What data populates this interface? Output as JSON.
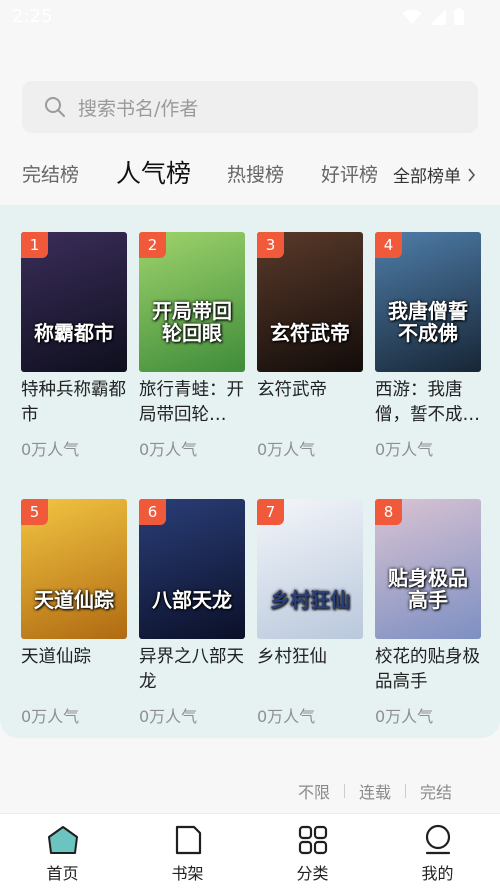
{
  "status_bar": {
    "time": "2:25"
  },
  "search": {
    "placeholder": "搜索书名/作者"
  },
  "tabs": [
    {
      "label": "完结榜",
      "active": false
    },
    {
      "label": "人气榜",
      "active": true
    },
    {
      "label": "热搜榜",
      "active": false
    },
    {
      "label": "好评榜",
      "active": false
    }
  ],
  "all_lists": {
    "label": "全部榜单",
    "icon": "chevron-right-icon"
  },
  "books": [
    {
      "rank": "1",
      "title": "特种兵称霸都市",
      "cover_text": "称霸都市",
      "popularity": "0万人气",
      "colors": [
        "#3b2d5a",
        "#0e0f1e"
      ]
    },
    {
      "rank": "2",
      "title": "旅行青蛙：开局带回轮…",
      "cover_text": "开局带回轮回眼",
      "popularity": "0万人气",
      "colors": [
        "#9fd36c",
        "#3f8c3a"
      ]
    },
    {
      "rank": "3",
      "title": "玄符武帝",
      "cover_text": "玄符武帝",
      "popularity": "0万人气",
      "colors": [
        "#5a3a2a",
        "#120c0a"
      ]
    },
    {
      "rank": "4",
      "title": "西游：我唐僧，誓不成…",
      "cover_text": "我唐僧誓不成佛",
      "popularity": "0万人气",
      "colors": [
        "#4f7eaa",
        "#172636"
      ]
    },
    {
      "rank": "5",
      "title": "天道仙踪",
      "cover_text": "天道仙踪",
      "popularity": "0万人气",
      "colors": [
        "#f2c542",
        "#b06a12"
      ]
    },
    {
      "rank": "6",
      "title": "异界之八部天龙",
      "cover_text": "八部天龙",
      "popularity": "0万人气",
      "colors": [
        "#2a3e78",
        "#0b1028"
      ]
    },
    {
      "rank": "7",
      "title": "乡村狂仙",
      "cover_text": "乡村狂仙",
      "popularity": "0万人气",
      "colors": [
        "#f4f6fa",
        "#b9c8dc"
      ]
    },
    {
      "rank": "8",
      "title": "校花的贴身极品高手",
      "cover_text": "贴身极品高手",
      "popularity": "0万人气",
      "colors": [
        "#d9c3d3",
        "#7d8fc2"
      ]
    }
  ],
  "filters": [
    {
      "label": "不限",
      "active": true
    },
    {
      "label": "连载",
      "active": false
    },
    {
      "label": "完结",
      "active": false
    }
  ],
  "bottom_nav": [
    {
      "label": "首页",
      "icon": "home-icon",
      "active": true
    },
    {
      "label": "书架",
      "icon": "bookshelf-icon",
      "active": false
    },
    {
      "label": "分类",
      "icon": "category-icon",
      "active": false
    },
    {
      "label": "我的",
      "icon": "profile-icon",
      "active": false
    }
  ],
  "colors": {
    "accent": "#6cc4c0",
    "rank_badge": "#f05a3b",
    "panel_bg": "#e6f2f2"
  }
}
